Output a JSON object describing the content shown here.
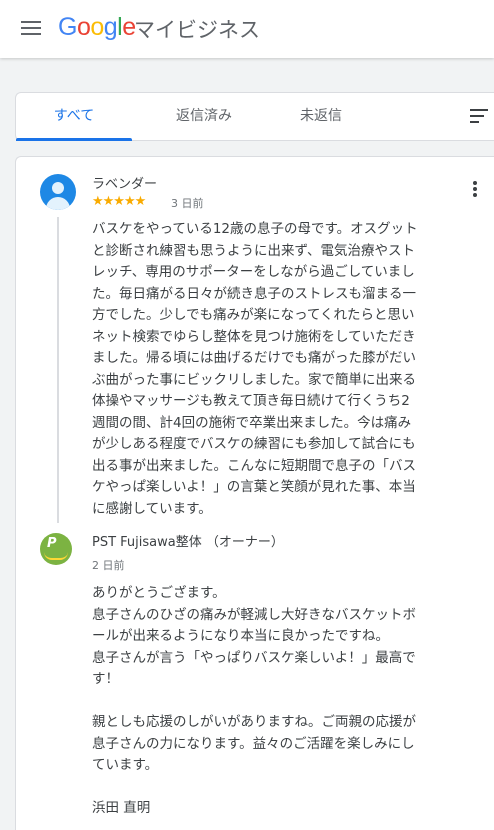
{
  "appbar": {
    "logo_letters": [
      "G",
      "o",
      "o",
      "g",
      "l",
      "e"
    ],
    "product": "マイビジネス"
  },
  "tabs": [
    {
      "label": "すべて",
      "active": true
    },
    {
      "label": "返信済み",
      "active": false
    },
    {
      "label": "未返信",
      "active": false
    }
  ],
  "review": {
    "reviewer": "ラベンダー",
    "rating": 5,
    "stars": "★★★★★",
    "time": "3 日前",
    "text": "バスケをやっている12歳の息子の母です。オスグットと診断され練習も思うように出来ず、電気治療やストレッチ、専用のサポーターをしながら過ごしていました。毎日痛がる日々が続き息子のストレスも溜まる一方でした。少しでも痛みが楽になってくれたらと思いネット検索でゆらし整体を見つけ施術をしていただきました。帰る頃には曲げるだけでも痛がった膝がだいぶ曲がった事にビックリしました。家で簡単に出来る体操やマッサージも教えて頂き毎日続けて行くうち2週間の間、計4回の施術で卒業出来ました。今は痛みが少しある程度でバスケの練習にも参加して試合にも出る事が出来ました。こんなに短期間で息子の「バスケやっぱ楽しいよ！」の言葉と笑顔が見れた事、本当に感謝しています。"
  },
  "reply": {
    "owner_name": "PST Fujisawa整体 （オーナー）",
    "time": "2 日前",
    "text": "ありがとうござます。\n息子さんのひざの痛みが軽減し大好きなバスケットボールが出来るようになり本当に良かったですね。\n息子さんが言う「やっぱりバスケ楽しいよ！」最高です！\n\n親としも応援のしがいがありますね。ご両親の応援が息子さんの力になります。益々のご活躍を楽しみにしています。\n\n浜田 直明"
  },
  "colors": {
    "accent": "#1a73e8",
    "star": "#f9ab00",
    "avatar": "#1e88e5",
    "owner_avatar": "#7cb342"
  },
  "icons": [
    "menu-icon",
    "sort-icon",
    "more-vert-icon",
    "user-avatar-icon",
    "business-logo-icon"
  ]
}
